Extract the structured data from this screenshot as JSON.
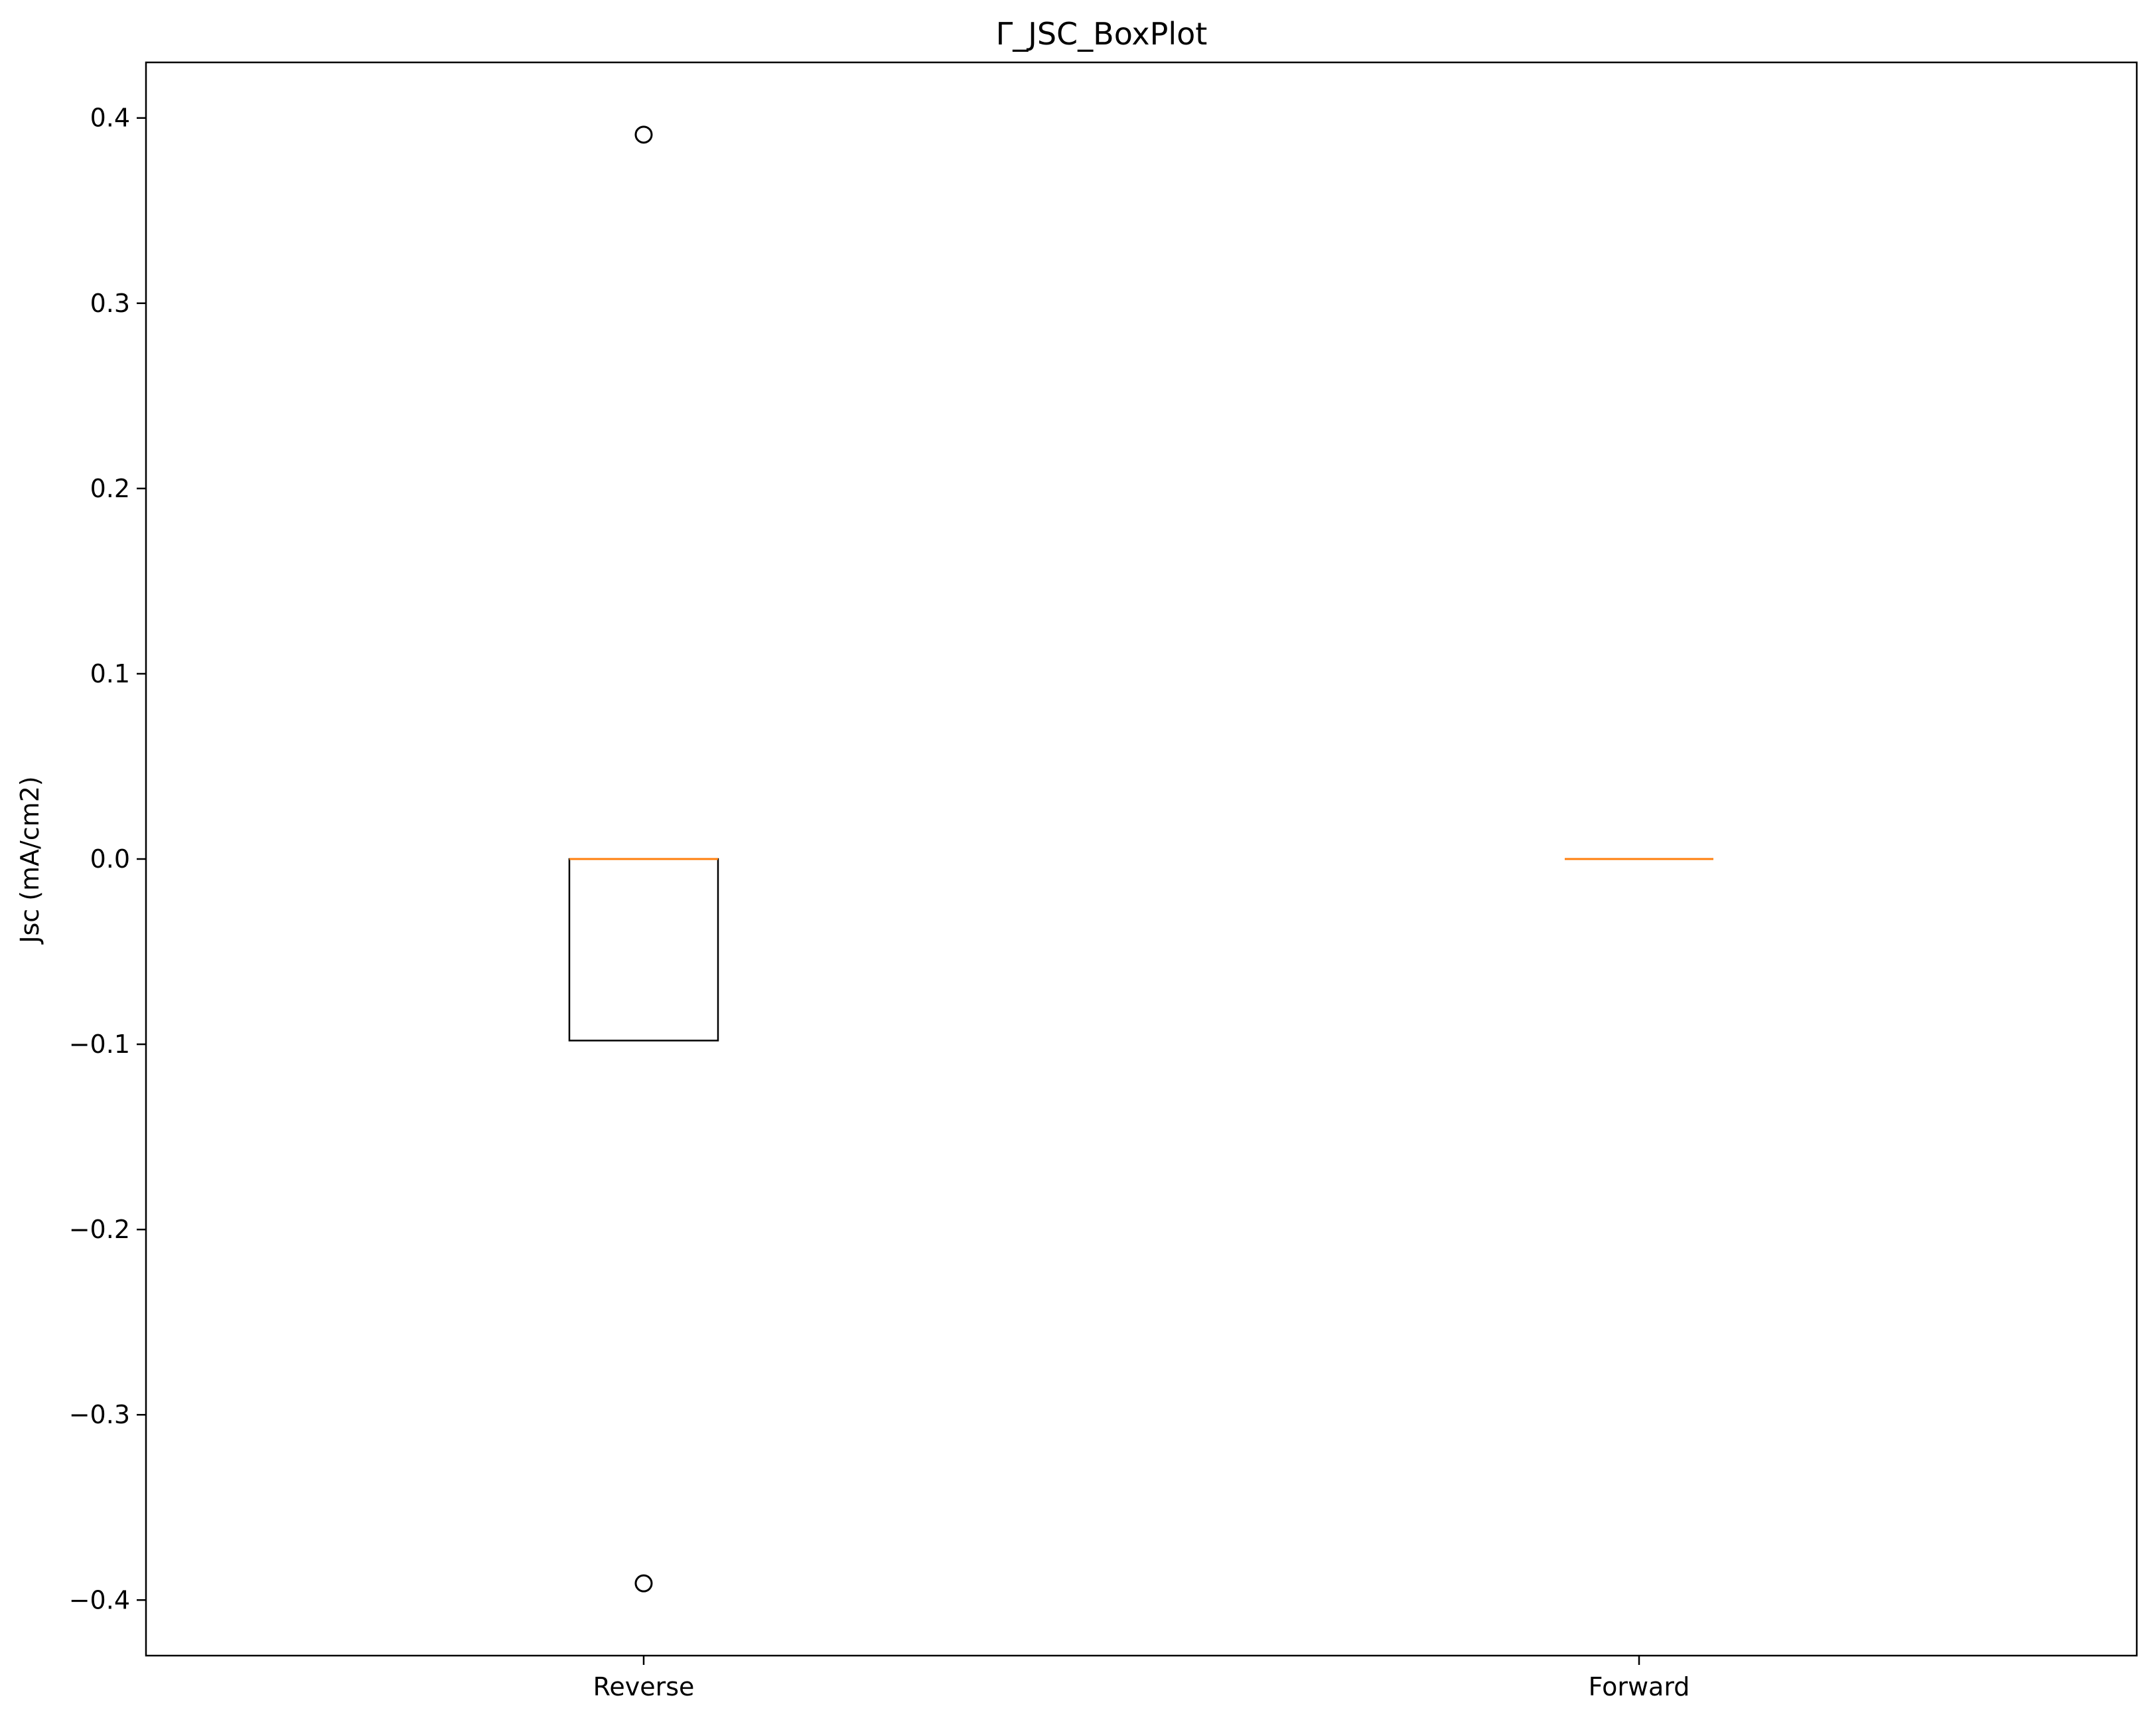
{
  "chart_data": {
    "type": "box",
    "title": "Γ_JSC_BoxPlot",
    "xlabel": "",
    "ylabel": "Jsc (mA/cm2)",
    "categories": [
      "Reverse",
      "Forward"
    ],
    "ylim": [
      -0.43,
      0.43
    ],
    "yticks": [
      -0.4,
      -0.3,
      -0.2,
      -0.1,
      0.0,
      0.1,
      0.2,
      0.3,
      0.4
    ],
    "ytick_labels": [
      "−0.4",
      "−0.3",
      "−0.2",
      "−0.1",
      "0.0",
      "0.1",
      "0.2",
      "0.3",
      "0.4"
    ],
    "boxes": [
      {
        "category": "Reverse",
        "whisker_low": -0.098,
        "q1": -0.098,
        "median": 0.0,
        "q3": 0.0,
        "whisker_high": 0.0,
        "outliers": [
          0.391,
          -0.391
        ]
      },
      {
        "category": "Forward",
        "whisker_low": 0.0,
        "q1": 0.0,
        "median": 0.0,
        "q3": 0.0,
        "whisker_high": 0.0,
        "outliers": []
      }
    ],
    "grid": false,
    "colors": {
      "box": "#000000",
      "median": "#ff7f0e",
      "outlier": "#000000"
    }
  }
}
